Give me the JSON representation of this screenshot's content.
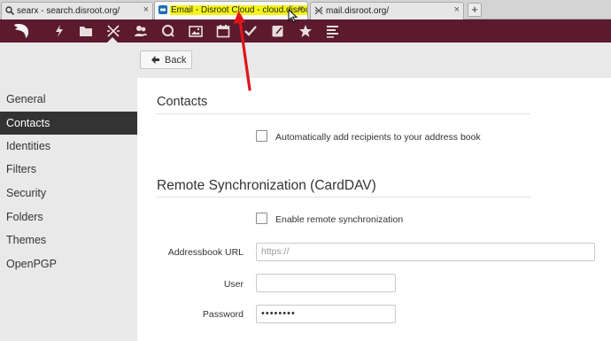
{
  "browser": {
    "tabs": [
      {
        "title": "searx - search.disroot.org/",
        "favicon": "magnifier-icon",
        "active": false
      },
      {
        "title": "Email - Disroot Cloud - cloud.disroot...",
        "favicon": "cloud-icon",
        "active": true
      },
      {
        "title": "mail.disroot.org/",
        "favicon": "mail-icon",
        "active": false
      }
    ],
    "new_tab": "+",
    "close": "×"
  },
  "appbar": {
    "icons": [
      "logo",
      "activity-icon",
      "folder-icon",
      "mail-icon",
      "contacts-icon",
      "search-icon",
      "gallery-icon",
      "calendar-icon",
      "tasks-icon",
      "notes-icon",
      "bookmarks-icon",
      "news-icon"
    ],
    "accent": "#5b1a2d"
  },
  "toolbar": {
    "back_label": "Back"
  },
  "sidebar": {
    "items": [
      {
        "label": "General",
        "active": false
      },
      {
        "label": "Contacts",
        "active": true
      },
      {
        "label": "Identities",
        "active": false
      },
      {
        "label": "Filters",
        "active": false
      },
      {
        "label": "Security",
        "active": false
      },
      {
        "label": "Folders",
        "active": false
      },
      {
        "label": "Themes",
        "active": false
      },
      {
        "label": "OpenPGP",
        "active": false
      }
    ]
  },
  "contacts": {
    "heading": "Contacts",
    "auto_add_label": "Automatically add recipients to your address book",
    "auto_add_checked": false
  },
  "sync": {
    "heading": "Remote Synchronization (CardDAV)",
    "enable_label": "Enable remote synchronization",
    "enable_checked": false,
    "url_label": "Addressbook URL",
    "url_placeholder": "https://",
    "user_label": "User",
    "user_value": "",
    "password_label": "Password",
    "password_value": "••••••••"
  }
}
